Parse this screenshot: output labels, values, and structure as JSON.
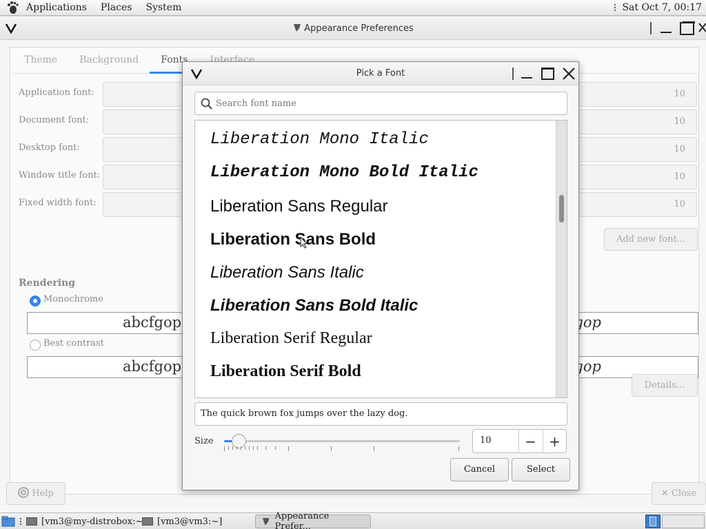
{
  "top_panel": {
    "menus": [
      "Applications",
      "Places",
      "System"
    ],
    "clock": "Sat Oct  7, 00:17"
  },
  "main_window": {
    "title": "Appearance Preferences",
    "tabs": [
      "Theme",
      "Background",
      "Fonts",
      "Interface"
    ],
    "active_tab": "Fonts",
    "font_rows": [
      {
        "label": "Application font:",
        "size": "10"
      },
      {
        "label": "Document font:",
        "size": "10"
      },
      {
        "label": "Desktop font:",
        "size": "10"
      },
      {
        "label": "Window title font:",
        "size": "10"
      },
      {
        "label": "Fixed width font:",
        "size": "10"
      }
    ],
    "add_font_button": "Add new font...",
    "rendering_heading": "Rendering",
    "rendering_options": [
      {
        "label": "Monochrome",
        "selected": true,
        "sample_left": "abcfgop A",
        "sample_right": "gop"
      },
      {
        "label": "Best contrast",
        "selected": false,
        "sample_left": "abcfgop A",
        "sample_right": "gop"
      }
    ],
    "details_button": "Details...",
    "help_button": "Help",
    "close_button": "Close"
  },
  "dialog": {
    "title": "Pick a Font",
    "search_placeholder": "Search font name",
    "fonts": [
      "Liberation Mono Italic",
      "Liberation Mono Bold Italic",
      "Liberation Sans Regular",
      "Liberation Sans Bold",
      "Liberation Sans Italic",
      "Liberation Sans Bold Italic",
      "Liberation Serif Regular",
      "Liberation Serif Bold"
    ],
    "preview_text": "The quick brown fox jumps over the lazy dog.",
    "size_label": "Size",
    "size_value": "10",
    "size_slider_position": 0.06,
    "minus": "−",
    "plus": "+",
    "cancel_button": "Cancel",
    "select_button": "Select"
  },
  "taskbar": {
    "tasks": [
      "[vm3@my-distrobox:~]",
      "[vm3@vm3:~]",
      "Appearance Prefer..."
    ]
  },
  "colors": {
    "accent": "#3584e4"
  }
}
